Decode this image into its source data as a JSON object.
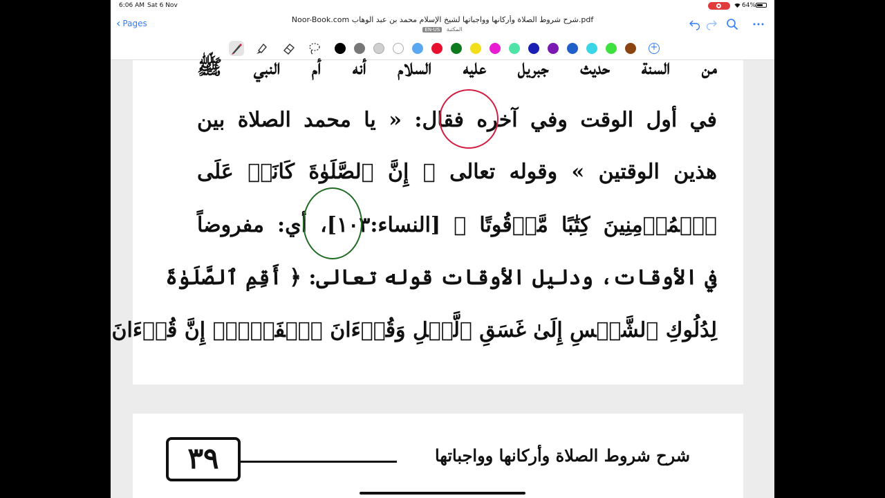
{
  "status_bar": {
    "time": "6:06 AM",
    "date": "Sat 6 Nov",
    "battery": "64%"
  },
  "toolbar": {
    "back_label": "Pages",
    "title": "Noor-Book.com  شرح شروط الصلاة وأركانها وواجباتها لشيخ الإسلام محمد بن عبد الوهاب.pdf",
    "language_badge": "EN-US",
    "subtitle": "المكتبة"
  },
  "colors": {
    "accent": "#2f7cf6",
    "swatches": [
      "#000000",
      "#777777",
      "#cfcfcf",
      "#ffffff",
      "#5aa8f0",
      "#e8102f",
      "#0d7a1d",
      "#f2de1a",
      "#e81bd0",
      "#4fe3a8",
      "#1a1fb3",
      "#7a1ab3",
      "#1f5fc7",
      "#3ad6e8",
      "#3fe03f",
      "#8a4410"
    ],
    "selected_swatch_index": 5,
    "red_annotation": "#d21c40",
    "green_annotation": "#1f6b21"
  },
  "page1": {
    "lines": [
      "من السنة حديث جبريل عليه السلام أنه أم النبي ﷺ",
      "في أول الوقت وفي آخره فقال: « يا محمد الصلاة بين",
      "هذين الوقتين » وقوله تعالى ﴿ إِنَّ ٱلصَّلَوٰةَ كَانَتۡ عَلَى",
      "ٱلۡمُؤۡمِنِينَ كِتَٰبًا مَّوۡقُوتًا ﴾ [النساء:١٠٣]، أي: مفروضاً",
      "في الأوقات، ودليل الأوقات قوله تعالى: ﴿ أَقِمِ ٱلصَّلَوٰةَ",
      "لِدُلُوكِ ٱلشَّمۡسِ إِلَىٰ غَسَقِ ٱلَّيۡلِ وَقُرۡءَانَ ٱلۡفَجۡرِۖ إِنَّ قُرۡءَانَ"
    ]
  },
  "page2": {
    "page_number": "٣٩",
    "running_title": "شرح شروط الصلاة وأركانها وواجباتها"
  }
}
